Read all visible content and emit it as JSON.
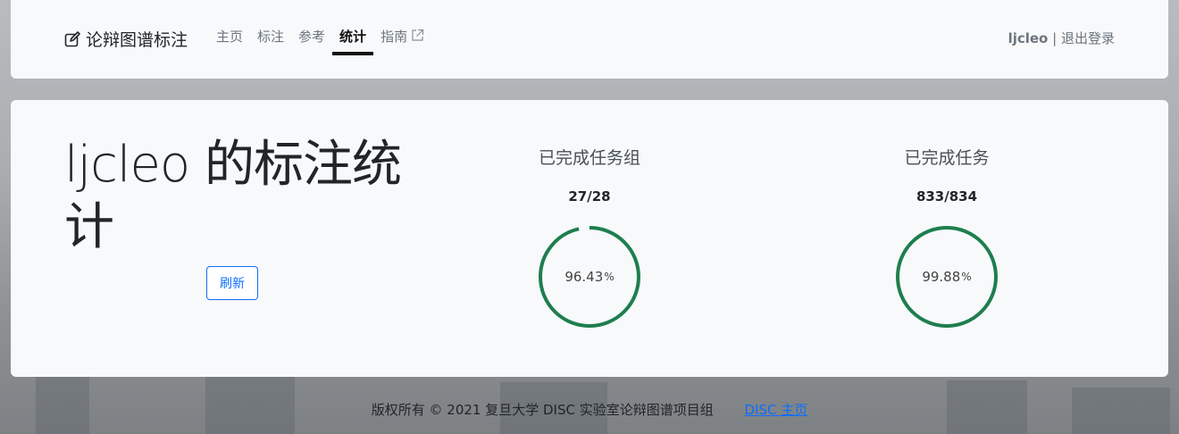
{
  "navbar": {
    "brand": "论辩图谱标注",
    "items": [
      {
        "label": "主页"
      },
      {
        "label": "标注"
      },
      {
        "label": "参考"
      },
      {
        "label": "统计"
      },
      {
        "label": "指南"
      }
    ],
    "username": "ljcleo",
    "separator": "|",
    "logout": "退出登录"
  },
  "main": {
    "title": "ljcleo 的标注统计",
    "refresh_label": "刷新",
    "stats": [
      {
        "label": "已完成任务组",
        "count": "27/28",
        "percent_text": "96.43",
        "percent_sign": "%",
        "fraction": 0.9643
      },
      {
        "label": "已完成任务",
        "count": "833/834",
        "percent_text": "99.88",
        "percent_sign": "%",
        "fraction": 0.9988
      }
    ]
  },
  "footer": {
    "copyright": "版权所有 © 2021 复旦大学 DISC 实验室论辩图谱项目组",
    "link_label": "DISC 主页"
  },
  "colors": {
    "ring": "#1e7e4e",
    "accent": "#0d6efd"
  }
}
